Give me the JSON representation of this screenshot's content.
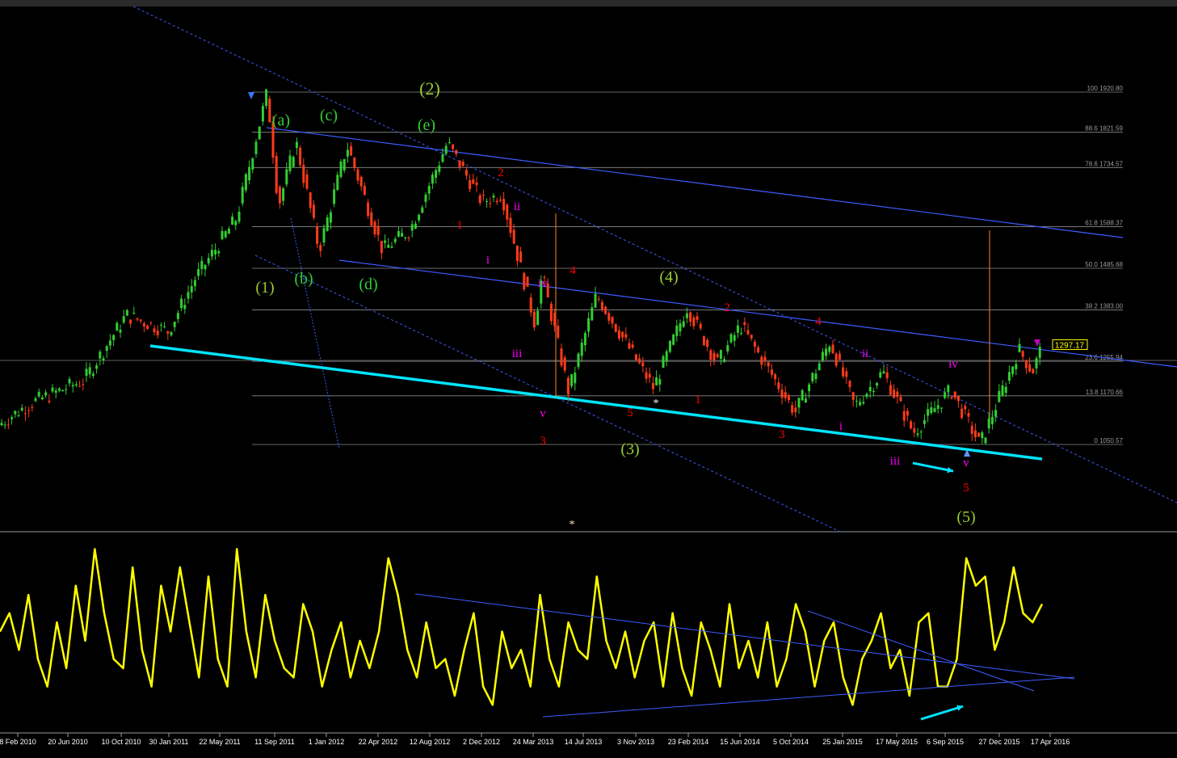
{
  "chart_data": [
    {
      "type": "candlestick",
      "panel": "main",
      "price_label": "1297.17",
      "fib_levels": [
        {
          "label": "100 1920.80",
          "value": 1920.8
        },
        {
          "label": "88.6 1821.59",
          "value": 1821.59
        },
        {
          "label": "78.6 1734.57",
          "value": 1734.57
        },
        {
          "label": "61.8 1588.37",
          "value": 1588.37
        },
        {
          "label": "50.0 1485.68",
          "value": 1485.68
        },
        {
          "label": "38.2 1383.00",
          "value": 1383.0
        },
        {
          "label": "23.6 1255.94",
          "value": 1255.94
        },
        {
          "label": "13.8 1170.66",
          "value": 1170.66
        },
        {
          "label": "0 1050.57",
          "value": 1050.57
        }
      ],
      "x_tick_labels": [
        "8 Feb 2010",
        "20 Jun 2010",
        "10 Oct 2010",
        "30 Jan 2011",
        "22 May 2011",
        "11 Sep 2011",
        "1 Jan 2012",
        "22 Apr 2012",
        "12 Aug 2012",
        "2 Dec 2012",
        "24 Mar 2013",
        "14 Jul 2013",
        "3 Nov 2013",
        "23 Feb 2014",
        "15 Jun 2014",
        "5 Oct 2014",
        "25 Jan 2015",
        "17 May 2015",
        "6 Sep 2015",
        "27 Dec 2015",
        "17 Apr 2016"
      ],
      "price_path": [
        {
          "date": "2010-01-01",
          "price": 1080
        },
        {
          "date": "2010-04-01",
          "price": 1150
        },
        {
          "date": "2010-08-01",
          "price": 1210
        },
        {
          "date": "2010-11-01",
          "price": 1370
        },
        {
          "date": "2011-02-01",
          "price": 1330
        },
        {
          "date": "2011-04-01",
          "price": 1460
        },
        {
          "date": "2011-07-01",
          "price": 1610
        },
        {
          "date": "2011-09-06",
          "price": 1920
        },
        {
          "date": "2011-10-01",
          "price": 1640
        },
        {
          "date": "2011-11-08",
          "price": 1800
        },
        {
          "date": "2011-12-29",
          "price": 1530
        },
        {
          "date": "2012-02-28",
          "price": 1790
        },
        {
          "date": "2012-05-16",
          "price": 1530
        },
        {
          "date": "2012-07-15",
          "price": 1580
        },
        {
          "date": "2012-10-05",
          "price": 1795
        },
        {
          "date": "2012-12-20",
          "price": 1650
        },
        {
          "date": "2013-02-01",
          "price": 1670
        },
        {
          "date": "2013-04-15",
          "price": 1350
        },
        {
          "date": "2013-05-01",
          "price": 1470
        },
        {
          "date": "2013-06-28",
          "price": 1180
        },
        {
          "date": "2013-08-28",
          "price": 1420
        },
        {
          "date": "2013-12-31",
          "price": 1190
        },
        {
          "date": "2014-03-14",
          "price": 1390
        },
        {
          "date": "2014-05-20",
          "price": 1250
        },
        {
          "date": "2014-07-10",
          "price": 1345
        },
        {
          "date": "2014-11-07",
          "price": 1130
        },
        {
          "date": "2015-01-22",
          "price": 1305
        },
        {
          "date": "2015-03-17",
          "price": 1145
        },
        {
          "date": "2015-05-18",
          "price": 1230
        },
        {
          "date": "2015-07-24",
          "price": 1080
        },
        {
          "date": "2015-10-14",
          "price": 1185
        },
        {
          "date": "2015-12-17",
          "price": 1050
        },
        {
          "date": "2016-03-11",
          "price": 1285
        },
        {
          "date": "2016-04-10",
          "price": 1230
        },
        {
          "date": "2016-05-02",
          "price": 1297
        }
      ],
      "wave_labels": [
        {
          "text": "(2)",
          "color": "#9acd32"
        },
        {
          "text": "(a)",
          "color": "#32cd32"
        },
        {
          "text": "(c)",
          "color": "#32cd32"
        },
        {
          "text": "(e)",
          "color": "#32cd32"
        },
        {
          "text": "(1)",
          "color": "#9acd32"
        },
        {
          "text": "(b)",
          "color": "#32cd32"
        },
        {
          "text": "(d)",
          "color": "#32cd32"
        },
        {
          "text": "(4)",
          "color": "#9acd32"
        },
        {
          "text": "(3)",
          "color": "#9acd32"
        },
        {
          "text": "(5)",
          "color": "#9acd32"
        },
        {
          "text": "1",
          "color": "#ff0000"
        },
        {
          "text": "2",
          "color": "#ff0000"
        },
        {
          "text": "3",
          "color": "#ff0000"
        },
        {
          "text": "4",
          "color": "#ff0000"
        },
        {
          "text": "5",
          "color": "#ff0000"
        },
        {
          "text": "2",
          "color": "#ff0000"
        },
        {
          "text": "1",
          "color": "#ff0000"
        },
        {
          "text": "4",
          "color": "#ff0000"
        },
        {
          "text": "3",
          "color": "#ff0000"
        },
        {
          "text": "5",
          "color": "#ff0000"
        },
        {
          "text": "i",
          "color": "#ff00ff"
        },
        {
          "text": "ii",
          "color": "#ff00ff"
        },
        {
          "text": "iii",
          "color": "#ff00ff"
        },
        {
          "text": "iv",
          "color": "#ff00ff"
        },
        {
          "text": "v",
          "color": "#ff00ff"
        },
        {
          "text": "ii",
          "color": "#ff00ff"
        },
        {
          "text": "i",
          "color": "#ff00ff"
        },
        {
          "text": "iii",
          "color": "#ff00ff"
        },
        {
          "text": "iv",
          "color": "#ff00ff"
        },
        {
          "text": "v",
          "color": "#ff00ff"
        },
        {
          "text": "*",
          "color": "#ffffff"
        },
        {
          "text": "*",
          "color": "#ffe4b5"
        }
      ]
    },
    {
      "type": "line",
      "panel": "oscillator",
      "series": [
        {
          "values": [
            50,
            60,
            40,
            70,
            35,
            20,
            55,
            30,
            75,
            45,
            95,
            60,
            35,
            30,
            85,
            40,
            20,
            75,
            50,
            85,
            55,
            25,
            80,
            35,
            20,
            95,
            50,
            25,
            70,
            45,
            30,
            25,
            65,
            50,
            20,
            40,
            55,
            25,
            45,
            30,
            50,
            90,
            70,
            40,
            25,
            55,
            30,
            35,
            15,
            40,
            60,
            20,
            10,
            50,
            30,
            40,
            20,
            70,
            35,
            20,
            55,
            40,
            35,
            80,
            45,
            30,
            50,
            25,
            45,
            55,
            20,
            60,
            30,
            15,
            55,
            40,
            20,
            65,
            30,
            45,
            25,
            55,
            20,
            35,
            65,
            50,
            20,
            45,
            55,
            25,
            10,
            35,
            45,
            60,
            30,
            40,
            15,
            55,
            60,
            20,
            20,
            35,
            90,
            75,
            80,
            40,
            55,
            85,
            60,
            55,
            65
          ]
        }
      ]
    }
  ],
  "colors": {
    "background": "#000000",
    "bull_candle": "#32cd32",
    "bear_candle": "#ff3b1a",
    "trendline_main": "#00e5ff",
    "channel": "#3c5cff",
    "fib": "#8c8c8c",
    "oscillator": "#ffff00",
    "wick_spike": "#ff7f27"
  }
}
